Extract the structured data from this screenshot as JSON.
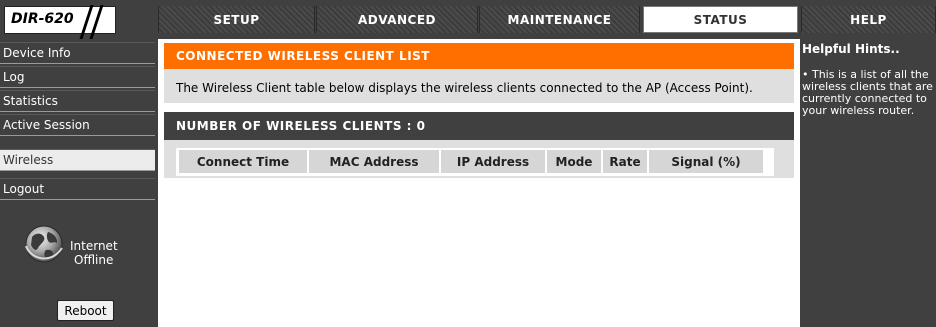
{
  "header": {
    "logo": "DIR-620",
    "tabs": [
      {
        "label": "SETUP"
      },
      {
        "label": "ADVANCED"
      },
      {
        "label": "MAINTENANCE"
      },
      {
        "label": "STATUS",
        "active": true
      },
      {
        "label": "HELP"
      }
    ]
  },
  "sidebar": {
    "items": [
      {
        "label": "Device Info"
      },
      {
        "label": "Log"
      },
      {
        "label": "Statistics"
      },
      {
        "label": "Active Session"
      },
      {
        "label": "Wireless",
        "selected": true
      },
      {
        "label": "Logout"
      }
    ],
    "status_line1": "Internet",
    "status_line2": "Offline",
    "reboot_label": "Reboot"
  },
  "main": {
    "section_title": "CONNECTED WIRELESS CLIENT LIST",
    "section_desc": "The Wireless Client table below displays the wireless clients connected to the AP (Access Point).",
    "clients_title": "NUMBER OF WIRELESS CLIENTS : 0",
    "columns": [
      "Connect Time",
      "MAC Address",
      "IP Address",
      "Mode",
      "Rate",
      "Signal (%)"
    ]
  },
  "hints": {
    "title": "Helpful Hints..",
    "body": "• This is a list of all the wireless clients that are currently connected to your wireless router."
  },
  "colors": {
    "accent": "#ff6f00",
    "dark": "#404040",
    "panel": "#dfdfdf"
  },
  "icons": {
    "internet_status": "globe-icon"
  }
}
